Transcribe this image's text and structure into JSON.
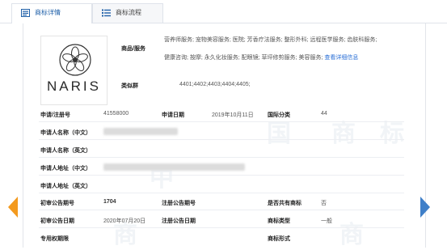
{
  "tabs": [
    {
      "label": "商标详情",
      "icon": "document-list-icon",
      "active": true
    },
    {
      "label": "商标流程",
      "icon": "flow-list-icon",
      "active": false
    }
  ],
  "logo": {
    "text": "NARIS",
    "icon": "flower-emblem-icon"
  },
  "goods": {
    "label": "商品/服务",
    "line1": "营养师服务; 宠物美容服务; 医院; 芳香疗法服务; 整形外科; 远程医学服务; 齿肤科服务;",
    "line2": "健康咨询; 按摩; 永久化妆服务; 配眼镜; 草坪修剪服务; 美容服务;",
    "more_link": "查看详细信息"
  },
  "similar_group": {
    "label": "类似群",
    "value": "4401;4402;4403;4404;4405;"
  },
  "fields": {
    "reg_no_label": "申请/注册号",
    "reg_no_value": "41558000",
    "apply_date_label": "申请日期",
    "apply_date_value": "2019年10月11日",
    "intl_class_label": "国际分类",
    "intl_class_value": "44",
    "applicant_cn_label": "申请人名称（中文）",
    "applicant_en_label": "申请人名称（英文）",
    "address_cn_label": "申请人地址（中文）",
    "address_en_label": "申请人地址（英文）",
    "prelim_no_label": "初审公告期号",
    "prelim_no_value": "1704",
    "reg_notice_no_label": "注册公告期号",
    "shared_label": "是否共有商标",
    "shared_value": "否",
    "prelim_date_label": "初审公告日期",
    "prelim_date_value": "2020年07月20日",
    "reg_notice_date_label": "注册公告日期",
    "tm_type_label": "商标类型",
    "tm_type_value": "一般",
    "exclusive_label": "专用权期限",
    "tm_form_label": "商标形式"
  },
  "navigation": {
    "prev_icon": "arrow-left-icon",
    "next_icon": "arrow-right-icon"
  },
  "colors": {
    "accent": "#1e5fa8",
    "link": "#2a6fd6",
    "prev_arrow": "#f39a1e",
    "next_arrow": "#3f7fc8"
  }
}
